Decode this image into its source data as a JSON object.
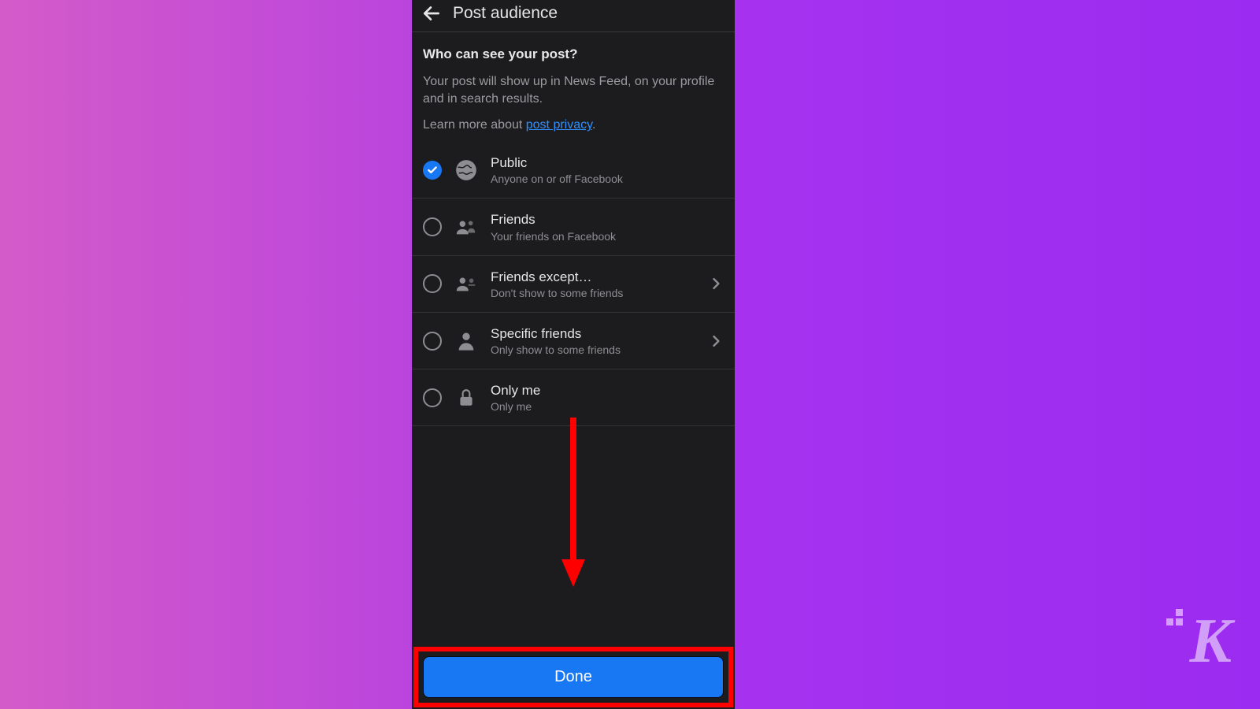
{
  "header": {
    "title": "Post audience"
  },
  "intro": {
    "heading": "Who can see your post?",
    "body": "Your post will show up in News Feed, on your profile and in search results.",
    "learn_prefix": "Learn more about ",
    "learn_link": "post privacy",
    "learn_suffix": "."
  },
  "options": [
    {
      "title": "Public",
      "subtitle": "Anyone on or off Facebook",
      "selected": true,
      "has_chevron": false,
      "icon": "globe"
    },
    {
      "title": "Friends",
      "subtitle": "Your friends on Facebook",
      "selected": false,
      "has_chevron": false,
      "icon": "friends"
    },
    {
      "title": "Friends except…",
      "subtitle": "Don't show to some friends",
      "selected": false,
      "has_chevron": true,
      "icon": "friends-except"
    },
    {
      "title": "Specific friends",
      "subtitle": "Only show to some friends",
      "selected": false,
      "has_chevron": true,
      "icon": "specific"
    },
    {
      "title": "Only me",
      "subtitle": "Only me",
      "selected": false,
      "has_chevron": false,
      "icon": "lock"
    }
  ],
  "done_label": "Done",
  "watermark": "K",
  "annotation": {
    "arrow_color": "#ff0000",
    "highlight_color": "#ff0000"
  }
}
